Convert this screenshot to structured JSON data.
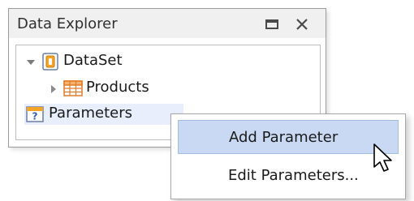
{
  "panel": {
    "title": "Data Explorer",
    "maximize_icon": "window-maximize-icon",
    "close_icon": "close-icon"
  },
  "tree": {
    "nodes": [
      {
        "label": "DataSet",
        "icon": "dataset-icon",
        "expanded": true
      },
      {
        "label": "Products",
        "icon": "table-icon",
        "expanded": false
      },
      {
        "label": "Parameters",
        "icon": "parameters-icon",
        "selected": true
      }
    ]
  },
  "context_menu": {
    "items": [
      {
        "label": "Add Parameter",
        "highlighted": true
      },
      {
        "label": "Edit Parameters..."
      }
    ]
  },
  "colors": {
    "menu_highlight": "#c9d9f3",
    "selection": "#e8eefb",
    "dataset_icon": "#f4a528",
    "table_icon": "#e07b2a"
  }
}
